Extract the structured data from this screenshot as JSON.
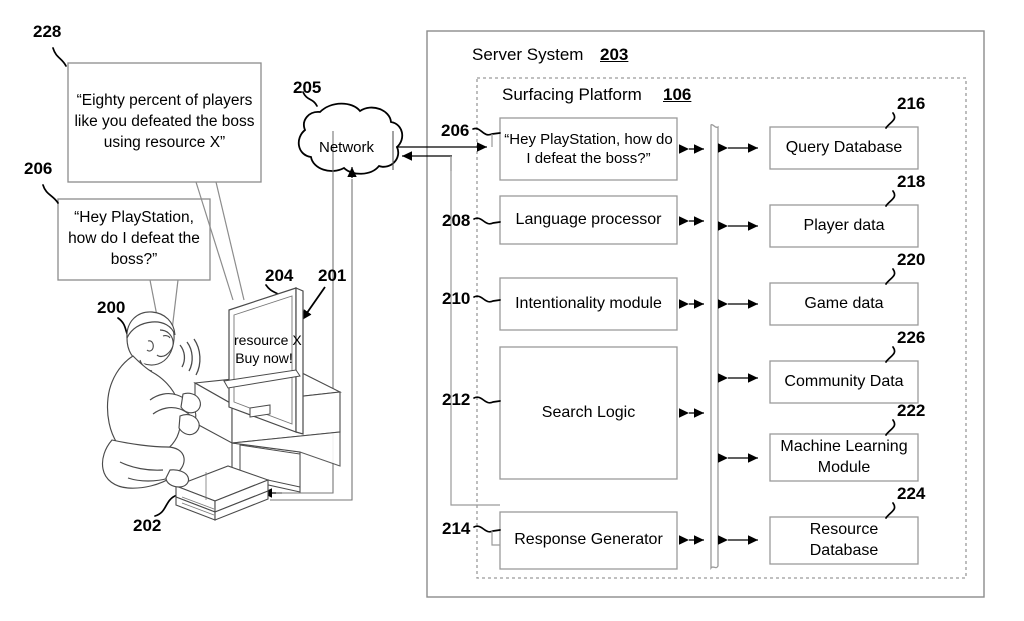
{
  "figure": {
    "title": "Server System / Surfacing Platform block diagram with player illustration",
    "server_system": {
      "label": "Server System",
      "ref": "203"
    },
    "surfacing_platform": {
      "label": "Surfacing Platform",
      "ref": "106"
    },
    "network": {
      "label": "Network",
      "ref": "205"
    },
    "bubbles": [
      {
        "ref": "228",
        "text": "“Eighty percent of players like you defeated the boss using resource X”"
      },
      {
        "ref": "206",
        "text": "“Hey PlayStation, how do I defeat the boss?”"
      }
    ],
    "illustration": {
      "player_ref": "200",
      "console_ref": "202",
      "tv_ref": "204",
      "screen_overlay_ref": "201",
      "screen_text_line1": "resource X",
      "screen_text_line2": "Buy now!"
    },
    "pipeline_boxes": [
      {
        "ref": "206",
        "label": "“Hey PlayStation, how do I defeat the boss?”",
        "multiline": true
      },
      {
        "ref": "208",
        "label": "Language processor",
        "multiline": false
      },
      {
        "ref": "210",
        "label": "Intentionality module",
        "multiline": false
      },
      {
        "ref": "212",
        "label": "Search Logic",
        "multiline": false
      },
      {
        "ref": "214",
        "label": "Response Generator",
        "multiline": false
      }
    ],
    "data_boxes": [
      {
        "ref": "216",
        "label": "Query Database"
      },
      {
        "ref": "218",
        "label": "Player data"
      },
      {
        "ref": "220",
        "label": "Game data"
      },
      {
        "ref": "226",
        "label": "Community Data"
      },
      {
        "ref": "222",
        "label": "Machine Learning Module"
      },
      {
        "ref": "224",
        "label": "Resource Database"
      }
    ],
    "colors": {
      "line": "#000000",
      "box_border": "#9a9a9a",
      "outer_border": "#8c8c8c",
      "background": "#ffffff"
    }
  }
}
